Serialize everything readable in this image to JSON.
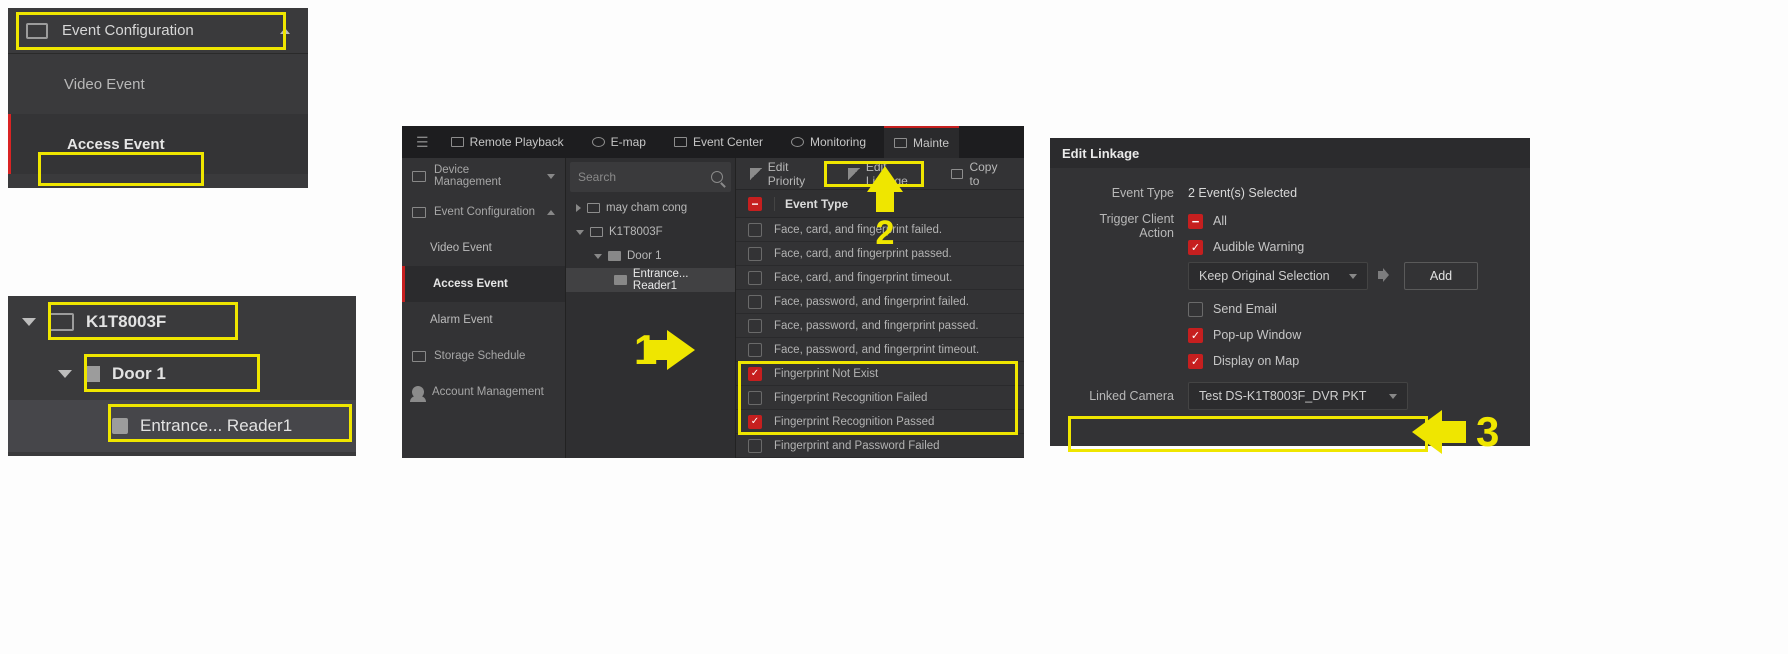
{
  "panel1": {
    "header": "Event Configuration",
    "items": [
      "Video Event",
      "Access Event"
    ],
    "active_index": 1
  },
  "panel2": {
    "device": "K1T8003F",
    "door": "Door 1",
    "reader": "Entrance... Reader1"
  },
  "panel3": {
    "topbar": {
      "items": [
        "Remote Playback",
        "E-map",
        "Event Center",
        "Monitoring",
        "Mainte"
      ],
      "active_index": 4
    },
    "left_nav": {
      "device_management": "Device Management",
      "event_configuration": "Event Configuration",
      "video_event": "Video Event",
      "access_event": "Access Event",
      "alarm_event": "Alarm Event",
      "storage_schedule": "Storage Schedule",
      "account_management": "Account Management"
    },
    "tree": {
      "search_placeholder": "Search",
      "nodes": {
        "n0": "may cham cong",
        "n1": "K1T8003F",
        "n2": "Door 1",
        "n3": "Entrance... Reader1"
      }
    },
    "toolbar": {
      "edit_priority": "Edit Priority",
      "edit_linkage": "Edit Linkage",
      "copy_to": "Copy to"
    },
    "list_header": {
      "col_event_type": "Event Type"
    },
    "events": [
      {
        "label": "Face, card, and fingerprint failed.",
        "checked": false
      },
      {
        "label": "Face, card, and fingerprint passed.",
        "checked": false
      },
      {
        "label": "Face, card, and fingerprint timeout.",
        "checked": false
      },
      {
        "label": "Face, password, and fingerprint failed.",
        "checked": false
      },
      {
        "label": "Face, password, and fingerprint passed.",
        "checked": false
      },
      {
        "label": "Face, password, and fingerprint timeout.",
        "checked": false
      },
      {
        "label": "Fingerprint Not Exist",
        "checked": true
      },
      {
        "label": "Fingerprint Recognition Failed",
        "checked": false
      },
      {
        "label": "Fingerprint Recognition Passed",
        "checked": true
      },
      {
        "label": "Fingerprint and Password Failed",
        "checked": false
      }
    ],
    "callouts": {
      "one": "1",
      "two": "2"
    }
  },
  "panel4": {
    "title": "Edit Linkage",
    "event_type_label": "Event Type",
    "event_type_value": "2 Event(s) Selected",
    "trigger_label": "Trigger Client Action",
    "actions": {
      "all": "All",
      "audible": "Audible Warning",
      "audio_select": "Keep Original Selection",
      "add_btn": "Add",
      "send_email": "Send Email",
      "popup": "Pop-up Window",
      "display_map": "Display on Map"
    },
    "linked_camera_label": "Linked Camera",
    "linked_camera_value": "Test DS-K1T8003F_DVR PKT"
  },
  "callout3": "3",
  "colors": {
    "accent": "#c61f1f",
    "highlight": "#efe600"
  }
}
